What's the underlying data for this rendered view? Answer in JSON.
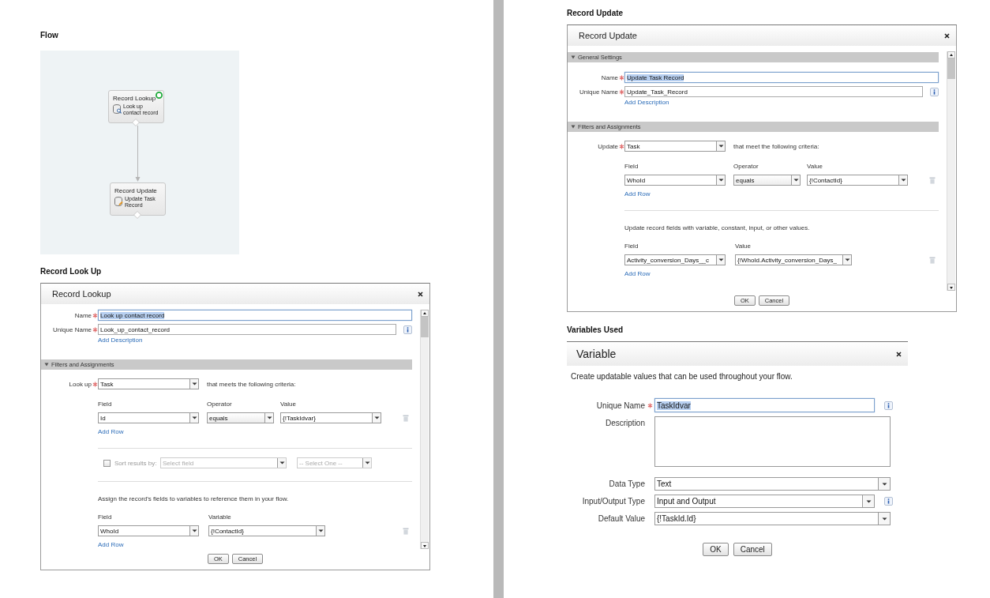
{
  "columns": [
    {
      "sections": [
        {
          "heading": "Flow",
          "kind": "flow",
          "nodes": [
            {
              "kind": "lookup",
              "title": "Record Lookup",
              "label": "Look up contact record",
              "start": true
            },
            {
              "kind": "update",
              "title": "Record Update",
              "label": "Update Task Record",
              "start": false
            }
          ]
        },
        {
          "heading": "Record Look Up",
          "kind": "dialog",
          "dialog": {
            "title": "Record Lookup",
            "scrollbar": true,
            "items": [
              {
                "kind": "field",
                "label": "Name",
                "required": true,
                "value": "Look up contact record",
                "focused": true,
                "info": false
              },
              {
                "kind": "field",
                "label": "Unique Name",
                "required": true,
                "value": "Look_up_contact_record",
                "focused": false,
                "info": true
              },
              {
                "kind": "link",
                "text": "Add Description"
              },
              {
                "kind": "header",
                "label": "Filters and Assignments",
                "expanded": true
              },
              {
                "kind": "object",
                "label": "Look up",
                "required": true,
                "value": "Task",
                "note": "that meets the following criteria:"
              },
              {
                "kind": "filter-grid",
                "columns": [
                  "Field",
                  "Operator",
                  "Value"
                ],
                "rows": [
                  [
                    "Id",
                    "equals",
                    "{!TaskIdvar}"
                  ]
                ],
                "link": "Add Row"
              },
              {
                "kind": "rule"
              },
              {
                "kind": "sort",
                "label": "Sort results by:",
                "checked": false,
                "disabled": true,
                "field_placeholder": "Select field",
                "order_placeholder": "-- Select One --"
              },
              {
                "kind": "rule"
              },
              {
                "kind": "note",
                "text": "Assign the record's fields to variables to reference them in your flow."
              },
              {
                "kind": "assign-grid",
                "columns": [
                  "Field",
                  "Variable"
                ],
                "rows": [
                  [
                    "WhoId",
                    "{!ContactId}"
                  ]
                ],
                "link": "Add Row"
              }
            ],
            "buttons": [
              "OK",
              "Cancel"
            ]
          }
        }
      ]
    },
    {
      "sections": [
        {
          "heading": "Record Update",
          "kind": "dialog",
          "dialog": {
            "title": "Record Update",
            "scrollbar": true,
            "items": [
              {
                "kind": "header",
                "label": "General Settings",
                "expanded": true
              },
              {
                "kind": "field",
                "label": "Name",
                "required": true,
                "value": "Update Task Record",
                "focused": true,
                "info": false
              },
              {
                "kind": "field",
                "label": "Unique Name",
                "required": true,
                "value": "Update_Task_Record",
                "focused": false,
                "info": true
              },
              {
                "kind": "link",
                "text": "Add Description"
              },
              {
                "kind": "header",
                "label": "Filters and Assignments",
                "expanded": true
              },
              {
                "kind": "object",
                "label": "Update",
                "required": true,
                "value": "Task",
                "note": "that meet the following criteria:"
              },
              {
                "kind": "filter-grid",
                "columns": [
                  "Field",
                  "Operator",
                  "Value"
                ],
                "rows": [
                  [
                    "WhoId",
                    "equals",
                    "{!ContactId}"
                  ]
                ],
                "link": "Add Row"
              },
              {
                "kind": "rule"
              },
              {
                "kind": "note",
                "text": "Update record fields with variable, constant, input, or other values."
              },
              {
                "kind": "assign-grid",
                "columns": [
                  "Field",
                  "Value"
                ],
                "rows": [
                  [
                    "Activity_conversion_Days__c",
                    "{!WhoId.Activity_conversion_Days_"
                  ]
                ],
                "link": "Add Row"
              }
            ],
            "buttons": [
              "OK",
              "Cancel"
            ]
          }
        },
        {
          "heading": "Variables Used",
          "kind": "form-dialog",
          "dialog": {
            "title": "Variable",
            "intro": "Create updatable values that can be used throughout your flow.",
            "items": [
              {
                "kind": "field",
                "label": "Unique Name",
                "required": true,
                "value": "TaskIdvar",
                "focused": true,
                "info": true
              },
              {
                "kind": "textarea",
                "label": "Description"
              },
              {
                "kind": "select",
                "label": "Data Type",
                "value": "Text",
                "info": false
              },
              {
                "kind": "select",
                "label": "Input/Output Type",
                "value": "Input and Output",
                "info": true
              },
              {
                "kind": "select",
                "label": "Default Value",
                "value": "{!TaskId.Id}",
                "info": false
              }
            ],
            "buttons": [
              "OK",
              "Cancel"
            ]
          }
        }
      ]
    }
  ]
}
